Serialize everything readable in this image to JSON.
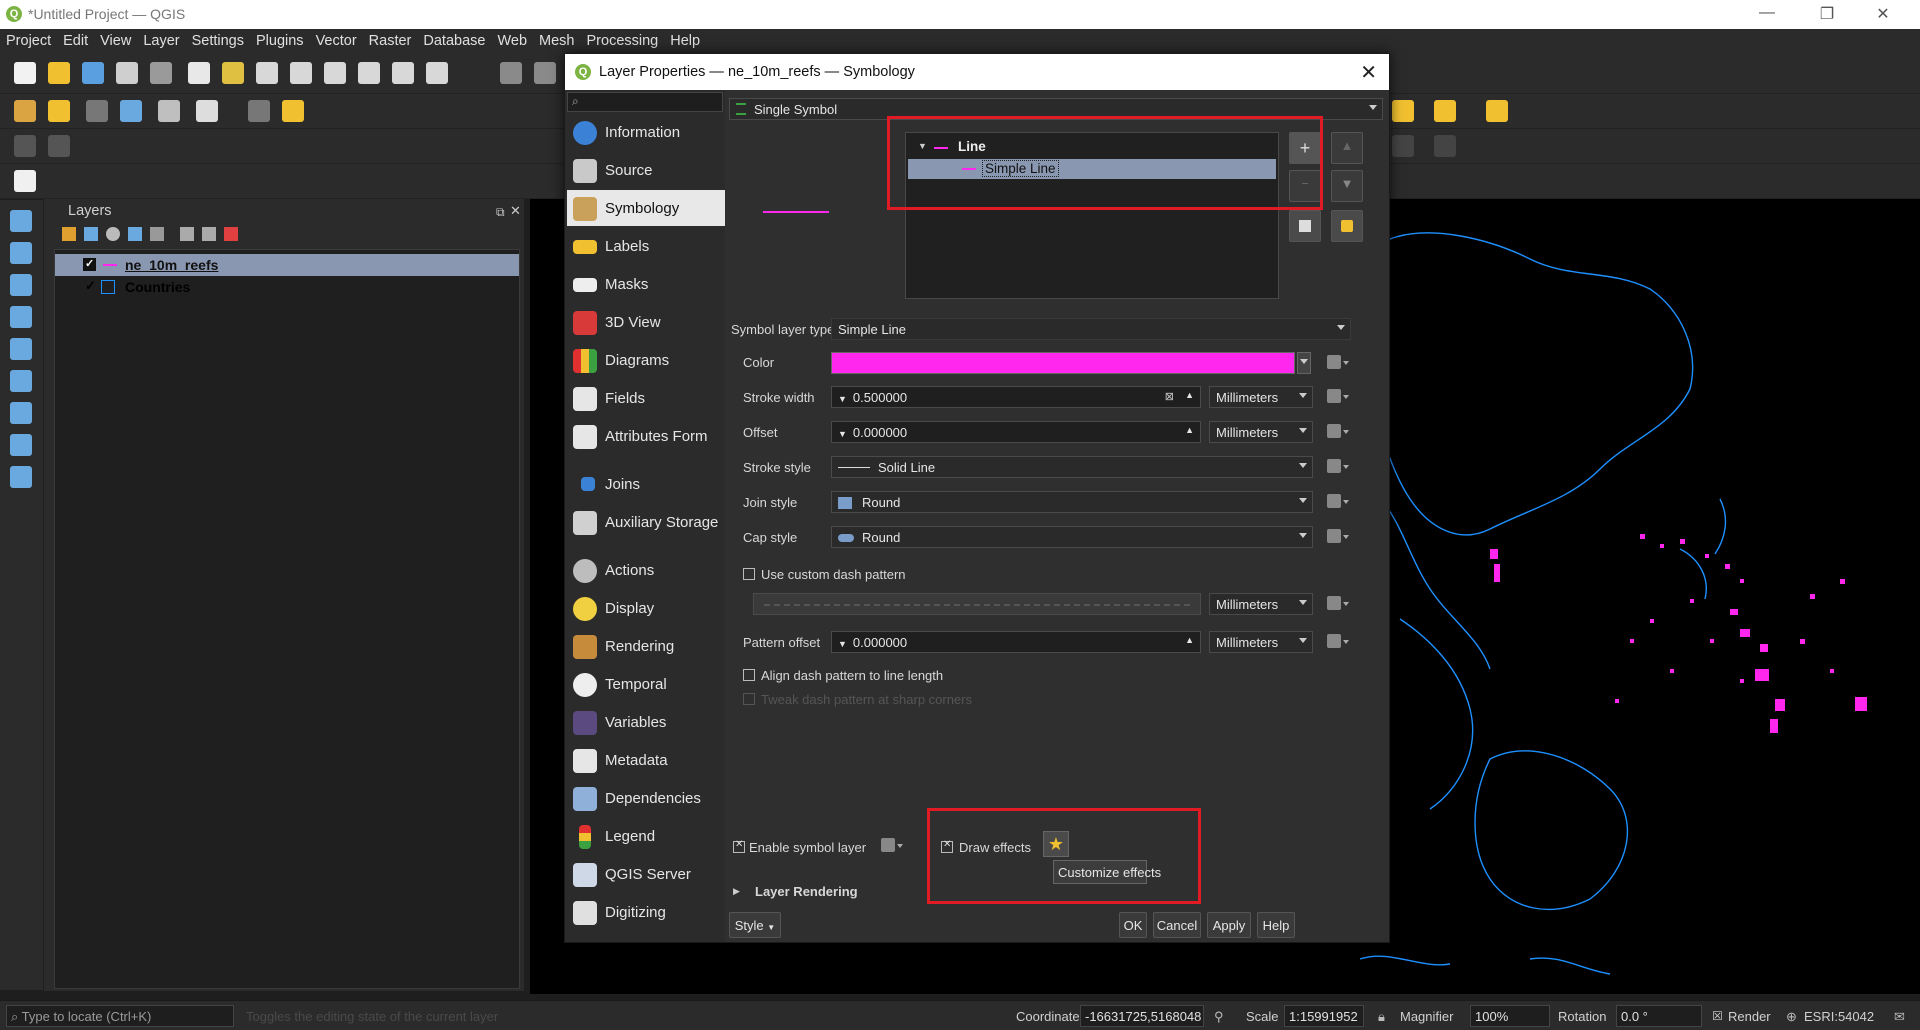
{
  "window": {
    "title": "*Untitled Project — QGIS"
  },
  "menu": [
    "Project",
    "Edit",
    "View",
    "Layer",
    "Settings",
    "Plugins",
    "Vector",
    "Raster",
    "Database",
    "Web",
    "Mesh",
    "Processing",
    "Help"
  ],
  "layers_panel": {
    "title": "Layers",
    "items": [
      {
        "name": "ne_10m_reefs",
        "checked": true,
        "selected": true
      },
      {
        "name": "Countries",
        "checked": true,
        "selected": false
      }
    ]
  },
  "dialog": {
    "title": "Layer Properties — ne_10m_reefs — Symbology",
    "nav": [
      "Information",
      "Source",
      "Symbology",
      "Labels",
      "Masks",
      "3D View",
      "Diagrams",
      "Fields",
      "Attributes Form",
      "Joins",
      "Auxiliary Storage",
      "Actions",
      "Display",
      "Rendering",
      "Temporal",
      "Variables",
      "Metadata",
      "Dependencies",
      "Legend",
      "QGIS Server",
      "Digitizing"
    ],
    "renderer": "Single Symbol",
    "tree": {
      "root": "Line",
      "child": "Simple Line"
    },
    "symbol_layer_type_label": "Symbol layer type",
    "symbol_layer_type": "Simple Line",
    "color_label": "Color",
    "color_value": "#ff27ee",
    "stroke_width_label": "Stroke width",
    "stroke_width": "0.500000",
    "offset_label": "Offset",
    "offset": "0.000000",
    "unit": "Millimeters",
    "stroke_style_label": "Stroke style",
    "stroke_style": "Solid Line",
    "join_style_label": "Join style",
    "join_style": "Round",
    "cap_style_label": "Cap style",
    "cap_style": "Round",
    "custom_dash": "Use custom dash pattern",
    "pattern_offset_label": "Pattern offset",
    "pattern_offset": "0.000000",
    "align_dash": "Align dash pattern to line length",
    "tweak_dash": "Tweak dash pattern at sharp corners",
    "enable_symbol_layer": "Enable symbol layer",
    "draw_effects": "Draw effects",
    "tooltip": "Customize effects",
    "layer_rendering": "Layer Rendering",
    "buttons": {
      "style": "Style",
      "ok": "OK",
      "cancel": "Cancel",
      "apply": "Apply",
      "help": "Help"
    }
  },
  "statusbar": {
    "locate_placeholder": "Type to locate (Ctrl+K)",
    "hint": "Toggles the editing state of the current layer",
    "coordinate_label": "Coordinate",
    "coordinate": "-16631725,5168048",
    "scale_label": "Scale",
    "scale": "1:15991952",
    "magnifier_label": "Magnifier",
    "magnifier": "100%",
    "rotation_label": "Rotation",
    "rotation": "0.0 °",
    "render_label": "Render",
    "crs": "ESRI:54042"
  },
  "colors": {
    "accent_red": "#e01b24",
    "reef_magenta": "#ff27ee",
    "coast_blue": "#1e90ff"
  }
}
